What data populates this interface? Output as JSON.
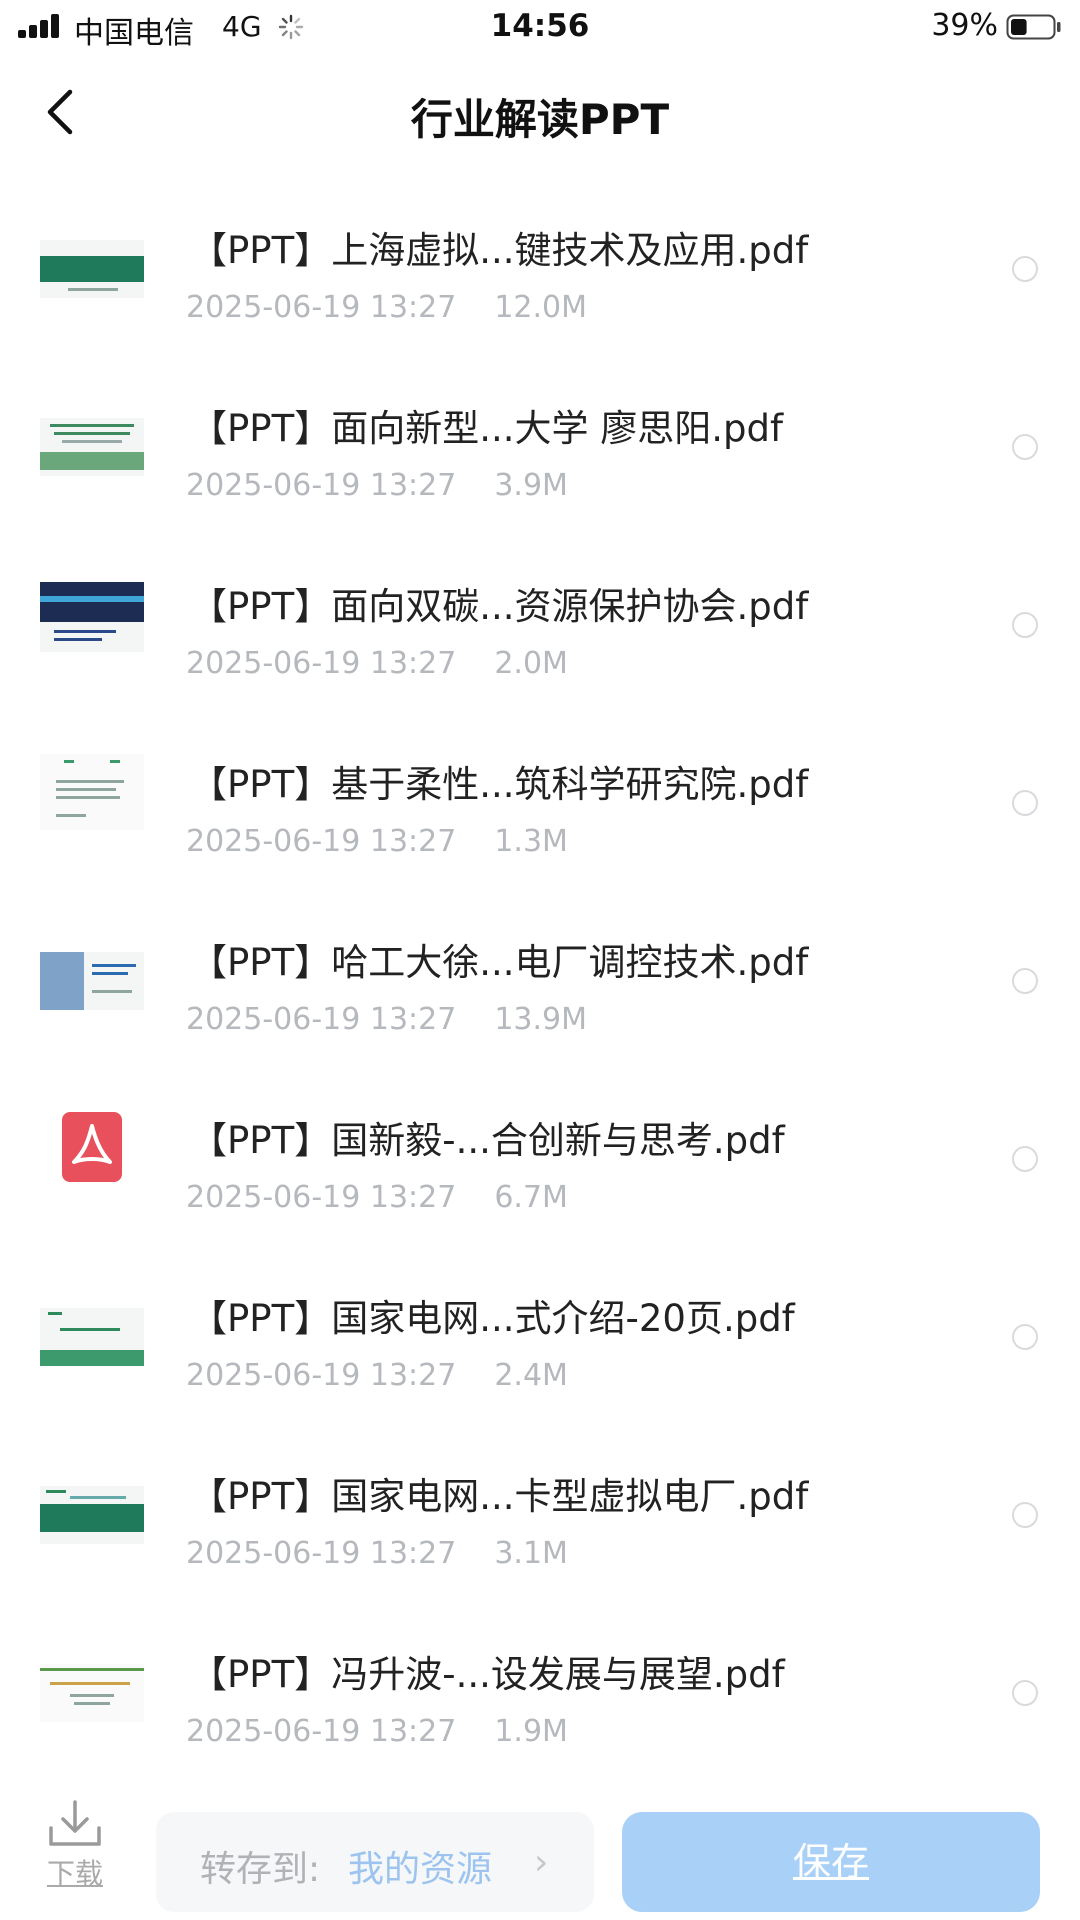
{
  "status_bar": {
    "carrier": "中国电信",
    "network": "4G",
    "time": "14:56",
    "battery_percent": "39%",
    "battery_level": 0.39
  },
  "nav": {
    "title": "行业解读PPT",
    "back_icon": "chevron-left-icon"
  },
  "files": [
    {
      "name": "【PPT】上海虚拟...键技术及应用.pdf",
      "date": "2025-06-19 13:27",
      "size": "12.0M",
      "thumb": "green-band"
    },
    {
      "name": "【PPT】面向新型...大学 廖思阳.pdf",
      "date": "2025-06-19 13:27",
      "size": "3.9M",
      "thumb": "green-landscape"
    },
    {
      "name": "【PPT】面向双碳...资源保护协会.pdf",
      "date": "2025-06-19 13:27",
      "size": "2.0M",
      "thumb": "city-night"
    },
    {
      "name": "【PPT】基于柔性...筑科学研究院.pdf",
      "date": "2025-06-19 13:27",
      "size": "1.3M",
      "thumb": "white-doc"
    },
    {
      "name": "【PPT】哈工大徐...电厂调控技术.pdf",
      "date": "2025-06-19 13:27",
      "size": "13.9M",
      "thumb": "blue-tower"
    },
    {
      "name": "【PPT】国新毅-...合创新与思考.pdf",
      "date": "2025-06-19 13:27",
      "size": "6.7M",
      "thumb": "pdf-icon"
    },
    {
      "name": "【PPT】国家电网...式介绍-20页.pdf",
      "date": "2025-06-19 13:27",
      "size": "2.4M",
      "thumb": "green-wave"
    },
    {
      "name": "【PPT】国家电网...卡型虚拟电厂.pdf",
      "date": "2025-06-19 13:27",
      "size": "3.1M",
      "thumb": "green-band-title"
    },
    {
      "name": "【PPT】冯升波-...设发展与展望.pdf",
      "date": "2025-06-19 13:27",
      "size": "1.9M",
      "thumb": "white-line"
    }
  ],
  "bottom_bar": {
    "download_label": "下载",
    "download_icon": "download-icon",
    "saveto_label": "转存到:",
    "saveto_target": "我的资源",
    "save_label": "保存"
  },
  "colors": {
    "save_button": "#a9d1f7",
    "saveto_target": "#9cc4ee",
    "meta_text": "#b5b8bc",
    "pdf_icon": "#e8505b"
  }
}
